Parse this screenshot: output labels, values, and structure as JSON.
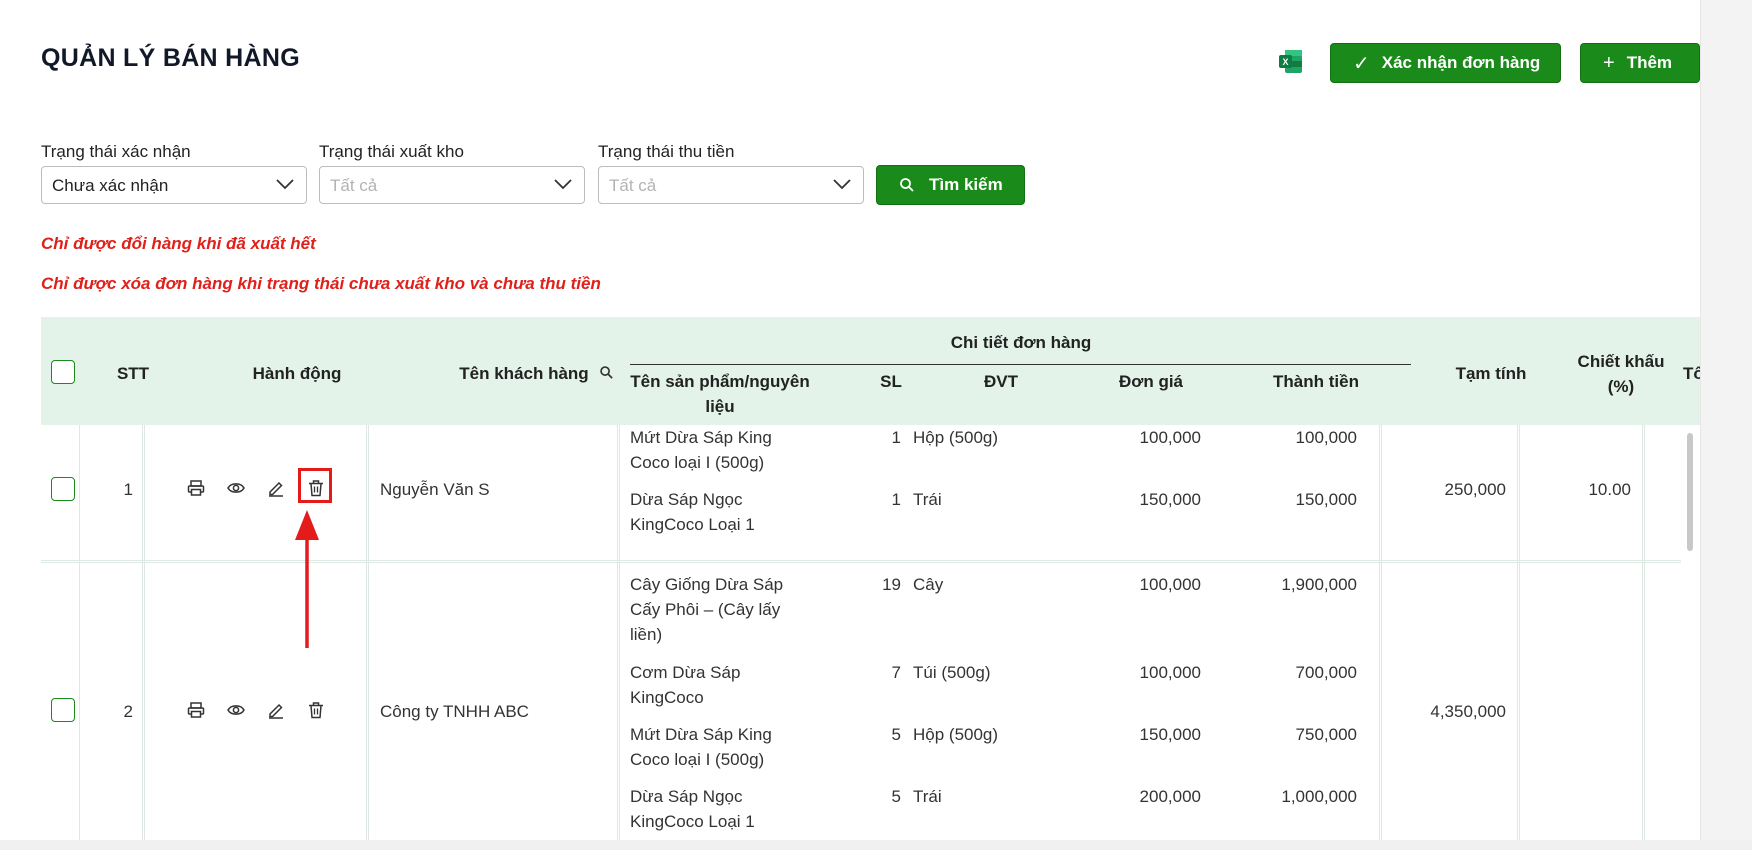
{
  "header": {
    "title": "QUẢN LÝ BÁN HÀNG",
    "confirm_label": "Xác nhận đơn hàng",
    "add_label": "Thêm",
    "excel_icon": "excel-icon"
  },
  "filters": {
    "confirm_status": {
      "label": "Trạng thái xác nhận",
      "value": "Chưa xác nhận"
    },
    "export_status": {
      "label": "Trạng thái xuất kho",
      "placeholder": "Tất cả"
    },
    "payment_status": {
      "label": "Trạng thái thu tiền",
      "placeholder": "Tất cả"
    },
    "search_label": "Tìm kiếm"
  },
  "notes": [
    "Chỉ được đổi hàng khi đã xuất hết",
    "Chỉ được xóa đơn hàng khi trạng thái chưa xuất kho và chưa thu tiền"
  ],
  "table": {
    "headers": {
      "stt": "STT",
      "actions": "Hành động",
      "customer": "Tên khách hàng",
      "detail_group": "Chi tiết đơn hàng",
      "product_line1": "Tên sản phẩm/nguyên",
      "product_line2": "liệu",
      "qty": "SL",
      "unit": "ĐVT",
      "price": "Đơn giá",
      "amount": "Thành tiền",
      "subtotal": "Tạm tính",
      "discount_line1": "Chiết khấu",
      "discount_line2": "(%)",
      "total_partial": "Tổn"
    },
    "rows": [
      {
        "stt": "1",
        "customer": "Nguyễn Văn S",
        "subtotal": "250,000",
        "discount": "10.00",
        "items": [
          {
            "name1": "Mứt Dừa Sáp King",
            "name2": "Coco loại I (500g)",
            "name3": "",
            "qty": "1",
            "unit": "Hộp (500g)",
            "price": "100,000",
            "amount": "100,000"
          },
          {
            "name1": "Dừa Sáp Ngọc",
            "name2": "KingCoco Loại 1",
            "name3": "",
            "qty": "1",
            "unit": "Trái",
            "price": "150,000",
            "amount": "150,000"
          }
        ]
      },
      {
        "stt": "2",
        "customer": "Công ty TNHH ABC",
        "subtotal": "4,350,000",
        "discount": "",
        "items": [
          {
            "name1": "Cây Giống Dừa Sáp",
            "name2": "Cấy Phôi – (Cây lấy",
            "name3": "liền)",
            "qty": "19",
            "unit": "Cây",
            "price": "100,000",
            "amount": "1,900,000"
          },
          {
            "name1": "Cơm Dừa Sáp",
            "name2": "KingCoco",
            "name3": "",
            "qty": "7",
            "unit": "Túi (500g)",
            "price": "100,000",
            "amount": "700,000"
          },
          {
            "name1": "Mứt Dừa Sáp King",
            "name2": "Coco loại I (500g)",
            "name3": "",
            "qty": "5",
            "unit": "Hộp (500g)",
            "price": "150,000",
            "amount": "750,000"
          },
          {
            "name1": "Dừa Sáp Ngọc",
            "name2": "KingCoco Loại 1",
            "name3": "",
            "qty": "5",
            "unit": "Trái",
            "price": "200,000",
            "amount": "1,000,000"
          }
        ]
      }
    ]
  },
  "colors": {
    "primary": "#1a8a1a",
    "header_bg": "#e3f3ea",
    "warning": "#e0201a",
    "highlight": "#e31b1b"
  }
}
